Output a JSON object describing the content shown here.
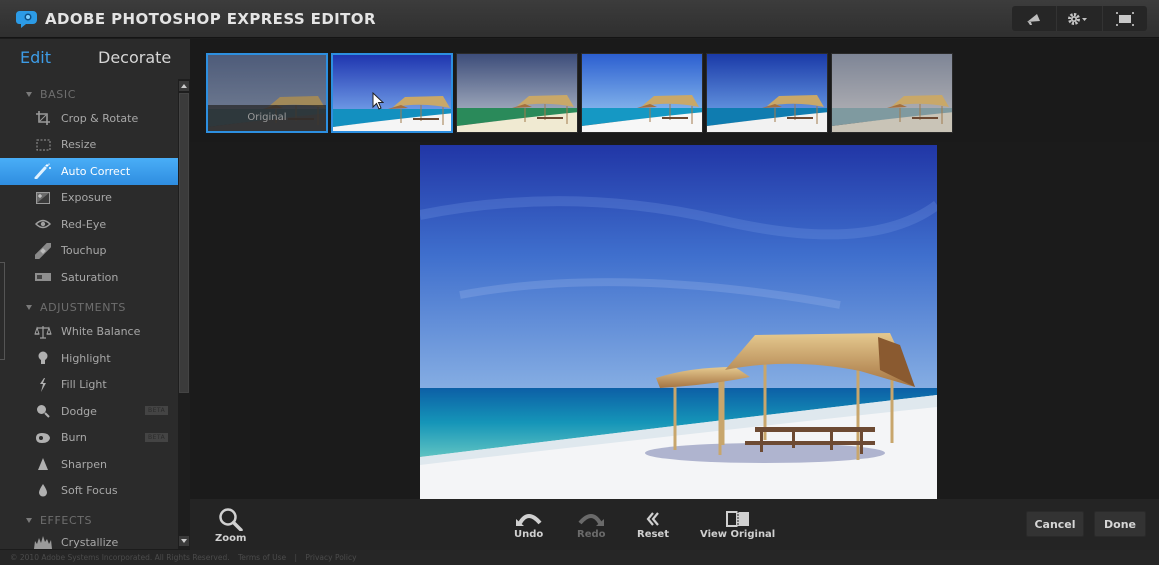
{
  "app": {
    "title": "ADOBE PHOTOSHOP EXPRESS EDITOR"
  },
  "top_tools": [
    {
      "name": "announcements",
      "icon": "megaphone-icon"
    },
    {
      "name": "settings",
      "icon": "gear-icon"
    },
    {
      "name": "fullscreen",
      "icon": "fullscreen-icon"
    }
  ],
  "mode_tabs": {
    "edit": "Edit",
    "decorate": "Decorate",
    "active": "Edit"
  },
  "sections": [
    {
      "title": "BASIC",
      "tools": [
        {
          "label": "Crop & Rotate",
          "icon": "crop-icon"
        },
        {
          "label": "Resize",
          "icon": "resize-icon"
        },
        {
          "label": "Auto Correct",
          "icon": "magic-wand-icon",
          "active": true
        },
        {
          "label": "Exposure",
          "icon": "exposure-icon"
        },
        {
          "label": "Red-Eye",
          "icon": "eye-icon"
        },
        {
          "label": "Touchup",
          "icon": "bandage-icon"
        },
        {
          "label": "Saturation",
          "icon": "saturation-icon"
        }
      ]
    },
    {
      "title": "ADJUSTMENTS",
      "tools": [
        {
          "label": "White Balance",
          "icon": "scales-icon"
        },
        {
          "label": "Highlight",
          "icon": "lightbulb-icon"
        },
        {
          "label": "Fill Light",
          "icon": "lightning-icon"
        },
        {
          "label": "Dodge",
          "icon": "dodge-icon",
          "badge": "BETA"
        },
        {
          "label": "Burn",
          "icon": "burn-icon",
          "badge": "BETA"
        },
        {
          "label": "Sharpen",
          "icon": "sharpen-icon"
        },
        {
          "label": "Soft Focus",
          "icon": "droplet-icon"
        }
      ]
    },
    {
      "title": "EFFECTS",
      "tools": [
        {
          "label": "Crystallize",
          "icon": "crystallize-icon"
        }
      ]
    }
  ],
  "thumbnails": [
    {
      "label": "Original",
      "variant": "original",
      "selected": true
    },
    {
      "label": "",
      "variant": "vivid",
      "selected": true,
      "hovered": true
    },
    {
      "label": "",
      "variant": "warm",
      "selected": false
    },
    {
      "label": "",
      "variant": "bright",
      "selected": false
    },
    {
      "label": "",
      "variant": "deep",
      "selected": false
    },
    {
      "label": "",
      "variant": "faded",
      "selected": false
    }
  ],
  "bottom_toolbar": {
    "zoom": "Zoom",
    "undo": "Undo",
    "redo": "Redo",
    "reset": "Reset",
    "view_original": "View Original",
    "cancel": "Cancel",
    "done": "Done"
  },
  "footer": {
    "copyright": "© 2010 Adobe Systems Incorporated. All Rights Reserved.",
    "terms": "Terms of Use",
    "separator": "|",
    "privacy": "Privacy Policy"
  }
}
